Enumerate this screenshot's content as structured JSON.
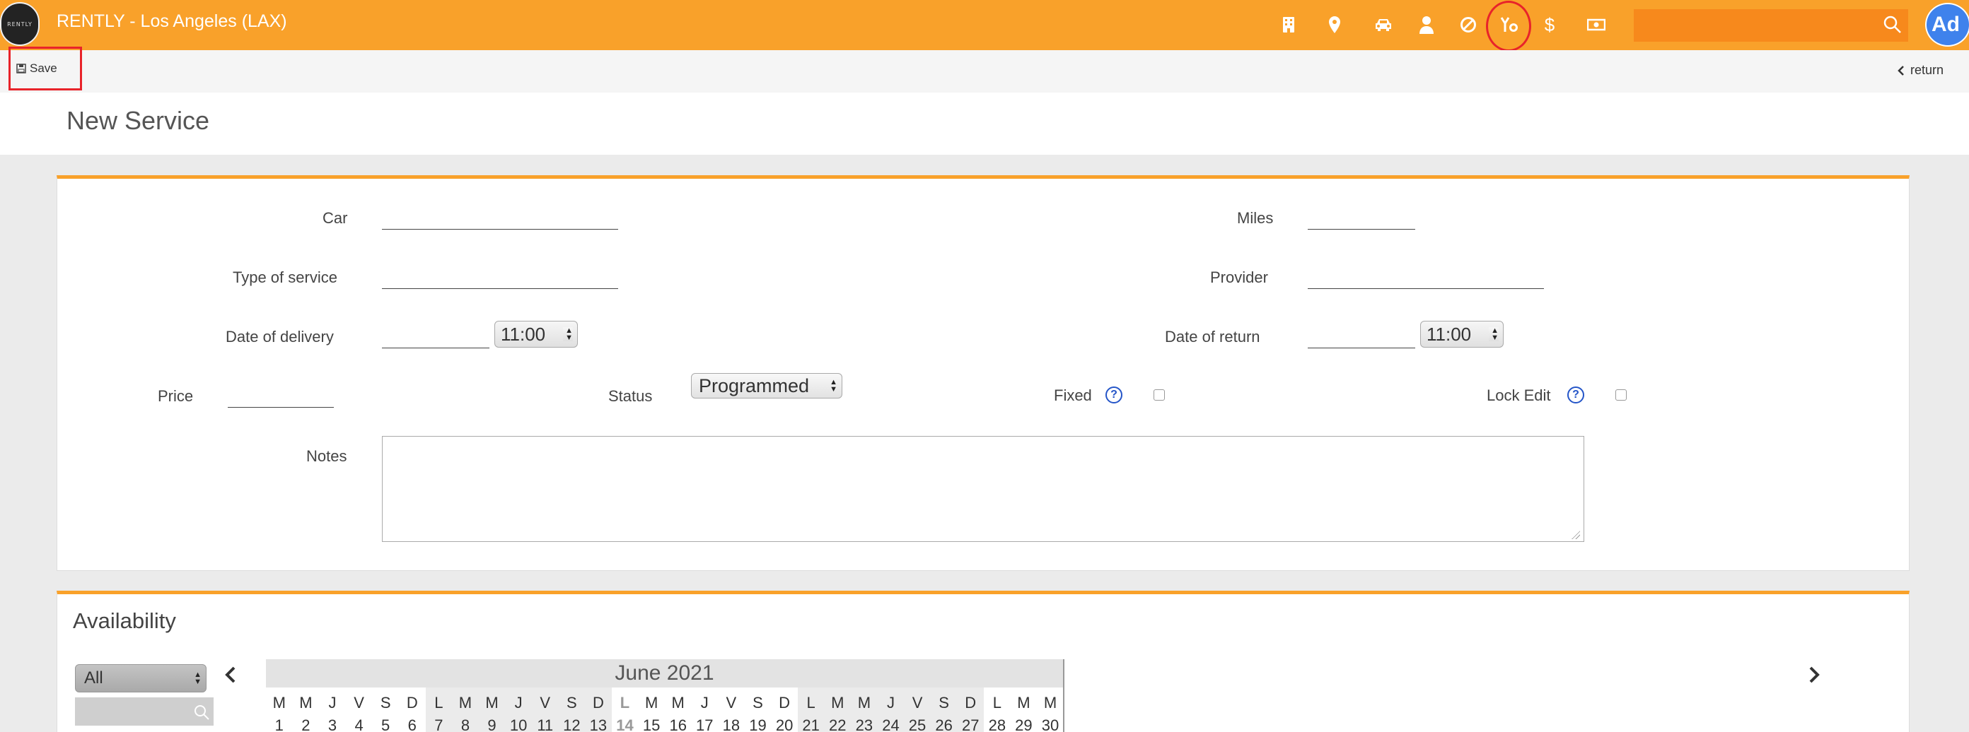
{
  "header": {
    "logo_text": "RENTLY",
    "title": "RENTLY - Los Angeles (LAX)",
    "nav_icons": [
      "building-icon",
      "map-pin-icon",
      "car-icon",
      "person-icon",
      "ban-icon",
      "service-icon",
      "dollar-icon",
      "cash-icon"
    ],
    "highlight_color": "#e8232a",
    "bar_color": "#f9a12a",
    "avatar_text": "Ad"
  },
  "toolbar": {
    "save_label": "Save",
    "return_label": "return"
  },
  "page": {
    "title": "New Service"
  },
  "form": {
    "car_label": "Car",
    "miles_label": "Miles",
    "type_label": "Type of service",
    "provider_label": "Provider",
    "delivery_label": "Date of delivery",
    "delivery_time": "11:00",
    "return_label": "Date of return",
    "return_time": "11:00",
    "price_label": "Price",
    "status_label": "Status",
    "status_value": "Programmed",
    "fixed_label": "Fixed",
    "lock_label": "Lock Edit",
    "help_glyph": "?",
    "notes_label": "Notes"
  },
  "availability": {
    "title": "Availability",
    "filter_value": "All",
    "month": "June 2021",
    "days": [
      {
        "w": "M",
        "d": "1"
      },
      {
        "w": "M",
        "d": "2"
      },
      {
        "w": "J",
        "d": "3"
      },
      {
        "w": "V",
        "d": "4"
      },
      {
        "w": "S",
        "d": "5"
      },
      {
        "w": "D",
        "d": "6"
      },
      {
        "w": "L",
        "d": "7",
        "wk": true
      },
      {
        "w": "M",
        "d": "8",
        "wk": true
      },
      {
        "w": "M",
        "d": "9",
        "wk": true
      },
      {
        "w": "J",
        "d": "10",
        "wk": true
      },
      {
        "w": "V",
        "d": "11",
        "wk": true
      },
      {
        "w": "S",
        "d": "12",
        "wk": true
      },
      {
        "w": "D",
        "d": "13",
        "wk": true
      },
      {
        "w": "L",
        "d": "14",
        "today": true
      },
      {
        "w": "M",
        "d": "15"
      },
      {
        "w": "M",
        "d": "16"
      },
      {
        "w": "J",
        "d": "17"
      },
      {
        "w": "V",
        "d": "18"
      },
      {
        "w": "S",
        "d": "19"
      },
      {
        "w": "D",
        "d": "20"
      },
      {
        "w": "L",
        "d": "21",
        "wk": true
      },
      {
        "w": "M",
        "d": "22",
        "wk": true
      },
      {
        "w": "M",
        "d": "23",
        "wk": true
      },
      {
        "w": "J",
        "d": "24",
        "wk": true
      },
      {
        "w": "V",
        "d": "25",
        "wk": true
      },
      {
        "w": "S",
        "d": "26",
        "wk": true
      },
      {
        "w": "D",
        "d": "27",
        "wk": true
      },
      {
        "w": "L",
        "d": "28"
      },
      {
        "w": "M",
        "d": "29"
      },
      {
        "w": "M",
        "d": "30"
      }
    ]
  }
}
